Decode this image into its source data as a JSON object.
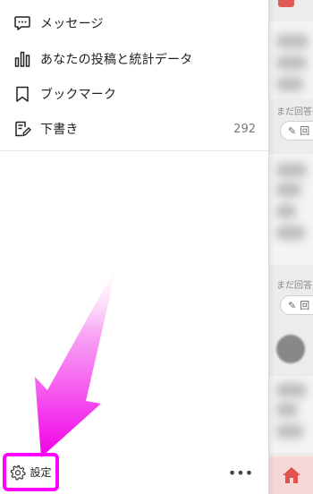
{
  "menu": {
    "items": [
      {
        "label": "メッセージ",
        "icon": "message-icon"
      },
      {
        "label": "あなたの投稿と統計データ",
        "icon": "bar-chart-icon"
      },
      {
        "label": "ブックマーク",
        "icon": "bookmark-icon"
      },
      {
        "label": "下書き",
        "icon": "draft-icon",
        "count": "292"
      }
    ]
  },
  "footer": {
    "settings_label": "設定",
    "more_label": "•••"
  },
  "background": {
    "answer_hint": "まだ回答",
    "answer_button": "回"
  },
  "colors": {
    "highlight": "#ff00ff",
    "home_tab": "#f6d8d8",
    "home_icon": "#e0524f"
  }
}
